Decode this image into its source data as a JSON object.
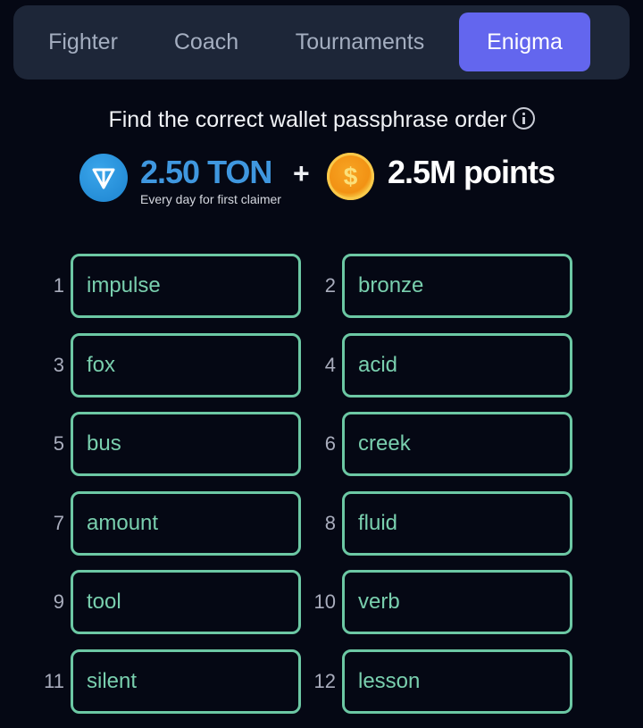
{
  "tabs": [
    {
      "label": "Fighter",
      "active": false
    },
    {
      "label": "Coach",
      "active": false
    },
    {
      "label": "Tournaments",
      "active": false
    },
    {
      "label": "Enigma",
      "active": true
    }
  ],
  "heading": "Find the correct wallet passphrase order",
  "reward": {
    "ton_icon": "ton-logo-icon",
    "ton_amount": "2.50 TON",
    "ton_subtitle": "Every day for first claimer",
    "plus": "+",
    "coin_icon": "dollar-coin-icon",
    "coin_symbol": "$",
    "points": "2.5M points"
  },
  "words": [
    {
      "num": "1",
      "word": "impulse"
    },
    {
      "num": "2",
      "word": "bronze"
    },
    {
      "num": "3",
      "word": "fox"
    },
    {
      "num": "4",
      "word": "acid"
    },
    {
      "num": "5",
      "word": "bus"
    },
    {
      "num": "6",
      "word": "creek"
    },
    {
      "num": "7",
      "word": "amount"
    },
    {
      "num": "8",
      "word": "fluid"
    },
    {
      "num": "9",
      "word": "tool"
    },
    {
      "num": "10",
      "word": "verb"
    },
    {
      "num": "11",
      "word": "silent"
    },
    {
      "num": "12",
      "word": "lesson"
    }
  ],
  "colors": {
    "accent": "#6366ee",
    "ton_blue": "#3f97df",
    "word_green": "#6cc8a4",
    "background": "#050814"
  }
}
